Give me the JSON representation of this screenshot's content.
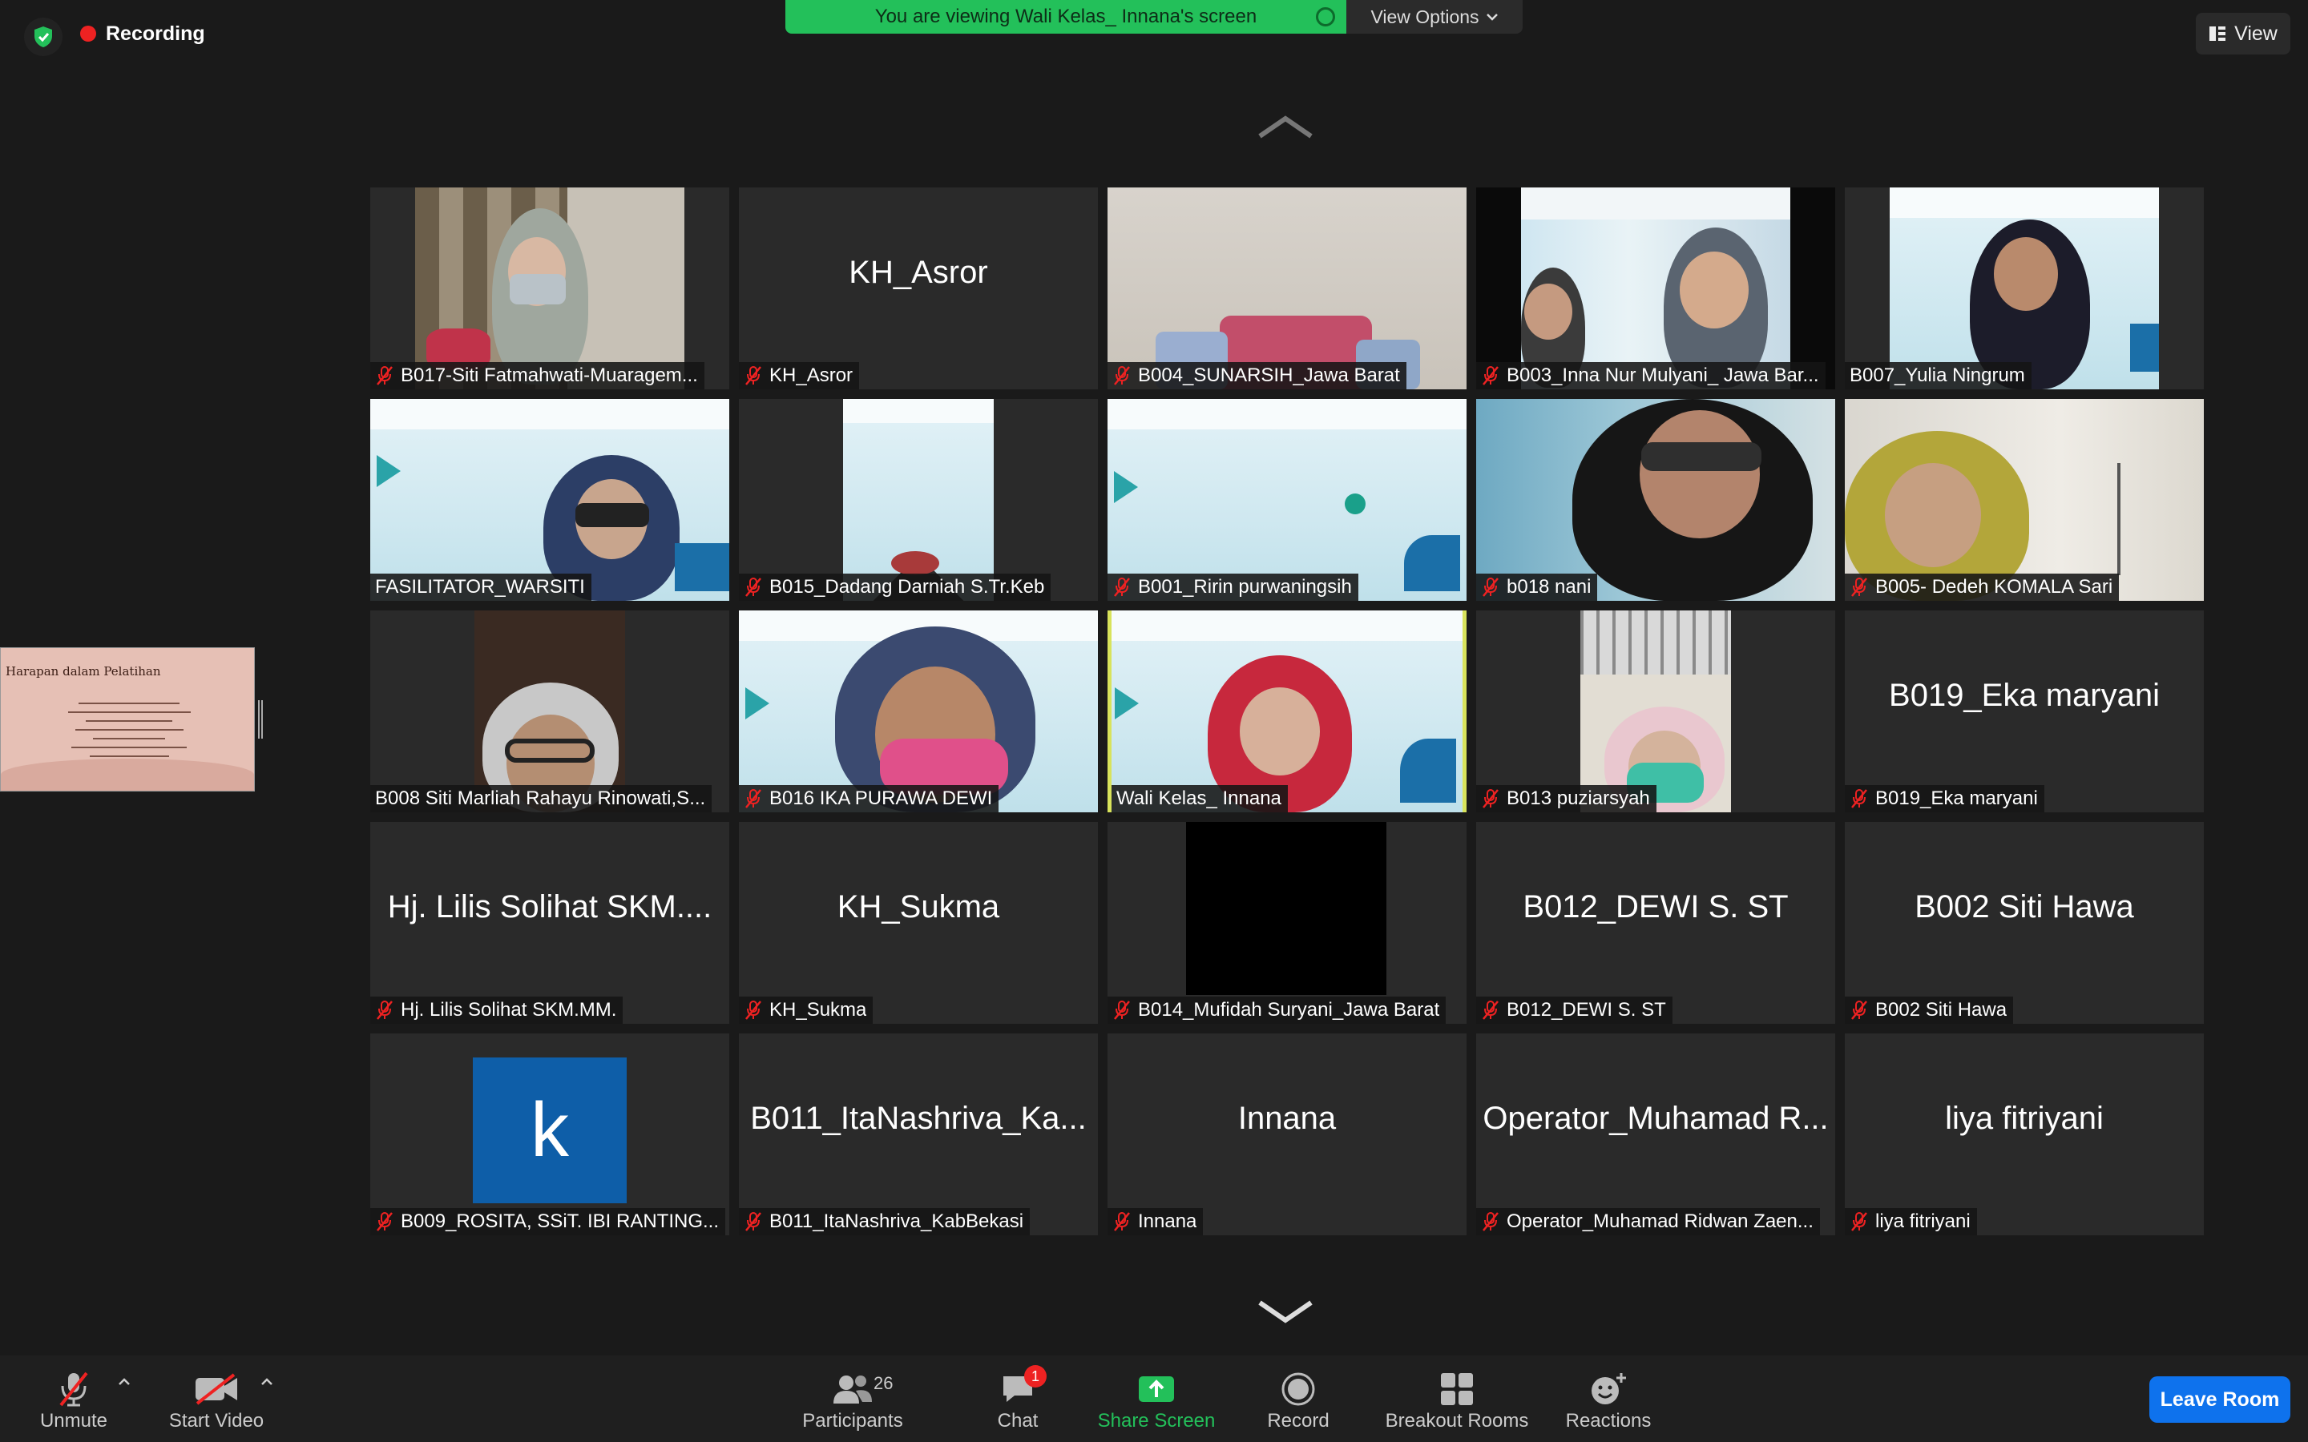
{
  "top": {
    "recording_label": "Recording",
    "banner_text": "You are viewing Wali Kelas_ Innana's screen",
    "view_options_label": "View Options",
    "view_label": "View"
  },
  "share_thumbnail": {
    "title": "Harapan dalam Pelatihan"
  },
  "tiles": [
    {
      "name": "B017-Siti Fatmahwati-Muaragem...",
      "muted": true
    },
    {
      "name": "KH_Asror",
      "display": "KH_Asror",
      "muted": true
    },
    {
      "name": "B004_SUNARSIH_Jawa Barat",
      "muted": true
    },
    {
      "name": "B003_Inna Nur Mulyani_ Jawa Bar...",
      "muted": true
    },
    {
      "name": "B007_Yulia Ningrum",
      "muted": false
    },
    {
      "name": "FASILITATOR_WARSITI",
      "muted": false
    },
    {
      "name": "B015_Dadang Darniah S.Tr.Keb",
      "muted": true
    },
    {
      "name": "B001_Ririn purwaningsih",
      "muted": true
    },
    {
      "name": "b018 nani",
      "muted": true
    },
    {
      "name": "B005- Dedeh KOMALA Sari",
      "muted": true
    },
    {
      "name": "B008 Siti Marliah Rahayu Rinowati,S...",
      "muted": false
    },
    {
      "name": "B016 IKA PURAWA DEWI",
      "muted": true
    },
    {
      "name": "Wali Kelas_ Innana",
      "muted": false
    },
    {
      "name": "B013 puziarsyah",
      "muted": true
    },
    {
      "name": "B019_Eka maryani",
      "display": "B019_Eka maryani",
      "muted": true
    },
    {
      "name": "Hj. Lilis Solihat SKM.MM.",
      "display": "Hj. Lilis Solihat SKM....",
      "muted": true
    },
    {
      "name": "KH_Sukma",
      "display": "KH_Sukma",
      "muted": true
    },
    {
      "name": "B014_Mufidah Suryani_Jawa Barat",
      "muted": true
    },
    {
      "name": "B012_DEWI S. ST",
      "display": "B012_DEWI S. ST",
      "muted": true
    },
    {
      "name": "B002 Siti Hawa",
      "display": "B002 Siti Hawa",
      "muted": true
    },
    {
      "name": "B009_ROSITA, SSiT. IBI RANTING...",
      "avatar_letter": "k",
      "muted": true
    },
    {
      "name": "B011_ItaNashriva_KabBekasi",
      "display": "B011_ItaNashriva_Ka...",
      "muted": true
    },
    {
      "name": "Innana",
      "display": "Innana",
      "muted": true
    },
    {
      "name": "Operator_Muhamad Ridwan Zaen...",
      "display": "Operator_Muhamad R...",
      "muted": true
    },
    {
      "name": "liya fitriyani",
      "display": "liya fitriyani",
      "muted": true
    }
  ],
  "toolbar": {
    "unmute": "Unmute",
    "start_video": "Start Video",
    "participants": "Participants",
    "participants_count": "26",
    "chat": "Chat",
    "chat_badge": "1",
    "share_screen": "Share Screen",
    "record": "Record",
    "breakout_rooms": "Breakout Rooms",
    "reactions": "Reactions",
    "leave_room": "Leave Room"
  },
  "colors": {
    "background": "#1a1a1a",
    "tile": "#2a2a2a",
    "banner_green": "#23c05a",
    "active_speaker": "#d8e35b",
    "leave_blue": "#0e72ed",
    "mute_red": "#e22222"
  }
}
